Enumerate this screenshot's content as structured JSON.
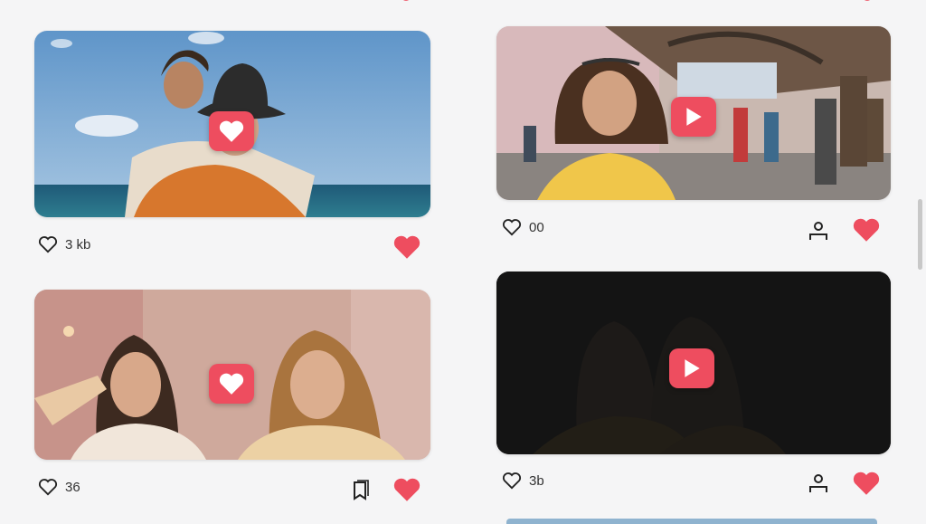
{
  "feed": {
    "posts": [
      {
        "likes": "3 kb",
        "media": "photo"
      },
      {
        "likes": "00",
        "media": "video"
      },
      {
        "likes": "36",
        "media": "photo"
      },
      {
        "likes": "3b",
        "media": "video"
      }
    ]
  },
  "icons": {
    "like_outline": "heart-outline-icon",
    "like_filled": "heart-filled-icon",
    "photo_overlay": "heart-badge-icon",
    "video_overlay": "play-icon",
    "user": "user-icon",
    "save": "bookmark-icon"
  },
  "colors": {
    "accent": "#ee4d5f",
    "background": "#f5f5f6",
    "text": "#333333"
  }
}
